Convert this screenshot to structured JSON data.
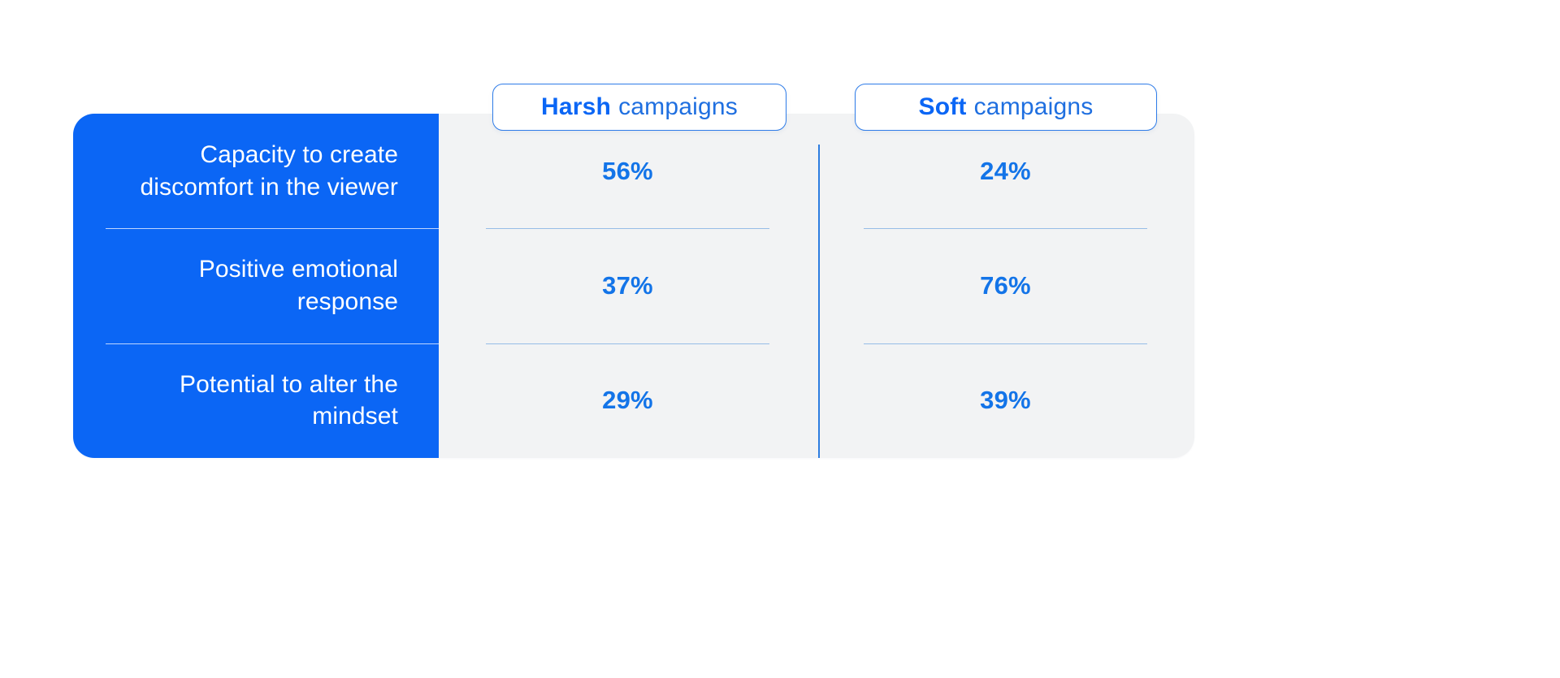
{
  "theme": {
    "accent_blue": "#0b66f5",
    "value_blue": "#1374e8",
    "panel_gray": "#f2f3f4",
    "divider_blue": "#2d7de0",
    "row_rule_blue": "#97bde6",
    "background": "#ffffff"
  },
  "comparison_table": {
    "column_headers": [
      {
        "emphasis": "Harsh",
        "rest": "campaigns"
      },
      {
        "emphasis": "Soft",
        "rest": "campaigns"
      }
    ],
    "rows": [
      {
        "label": "Capacity to create discomfort in the viewer",
        "harsh": "56%",
        "soft": "24%"
      },
      {
        "label": "Positive emotional response",
        "harsh": "37%",
        "soft": "76%"
      },
      {
        "label": "Potential to alter the mindset",
        "harsh": "29%",
        "soft": "39%"
      }
    ]
  },
  "chart_data": {
    "type": "table",
    "title": "",
    "categories": [
      "Capacity to create discomfort in the viewer",
      "Positive emotional response",
      "Potential to alter the mindset"
    ],
    "series": [
      {
        "name": "Harsh campaigns",
        "values": [
          56,
          37,
          29
        ]
      },
      {
        "name": "Soft campaigns",
        "values": [
          24,
          76,
          39
        ]
      }
    ],
    "unit": "%",
    "ylim": [
      0,
      100
    ],
    "grid": false,
    "legend_position": "top"
  }
}
